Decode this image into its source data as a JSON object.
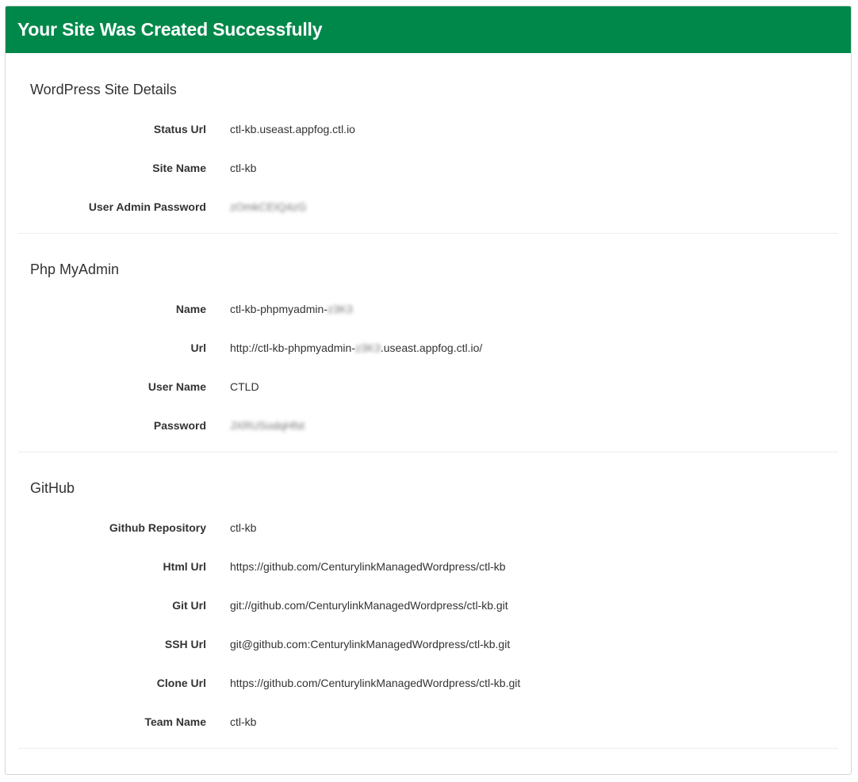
{
  "header": {
    "title": "Your Site Was Created Successfully",
    "background_color": "#00884a"
  },
  "sections": [
    {
      "title": "WordPress Site Details",
      "rows": [
        {
          "label": "Status Url",
          "value": "ctl-kb.useast.appfog.ctl.io"
        },
        {
          "label": "Site Name",
          "value": "ctl-kb"
        },
        {
          "label": "User Admin Password",
          "value": "zOmkCEIQ4zG"
        }
      ]
    },
    {
      "title": "Php MyAdmin",
      "rows": [
        {
          "label": "Name",
          "value_prefix": "ctl-kb-phpmyadmin-",
          "value_redacted": "z3K3",
          "value_suffix": ""
        },
        {
          "label": "Url",
          "value_prefix": "http://ctl-kb-phpmyadmin-",
          "value_redacted": "z3K3",
          "value_suffix": ".useast.appfog.ctl.io/"
        },
        {
          "label": "User Name",
          "value": "CTLD"
        },
        {
          "label": "Password",
          "value": "JXRUSodqHfst"
        }
      ]
    },
    {
      "title": "GitHub",
      "rows": [
        {
          "label": "Github Repository",
          "value": "ctl-kb"
        },
        {
          "label": "Html Url",
          "value": "https://github.com/CenturylinkManagedWordpress/ctl-kb"
        },
        {
          "label": "Git Url",
          "value": "git://github.com/CenturylinkManagedWordpress/ctl-kb.git"
        },
        {
          "label": "SSH Url",
          "value": "git@github.com:CenturylinkManagedWordpress/ctl-kb.git"
        },
        {
          "label": "Clone Url",
          "value": "https://github.com/CenturylinkManagedWordpress/ctl-kb.git"
        },
        {
          "label": "Team Name",
          "value": "ctl-kb"
        }
      ]
    }
  ]
}
